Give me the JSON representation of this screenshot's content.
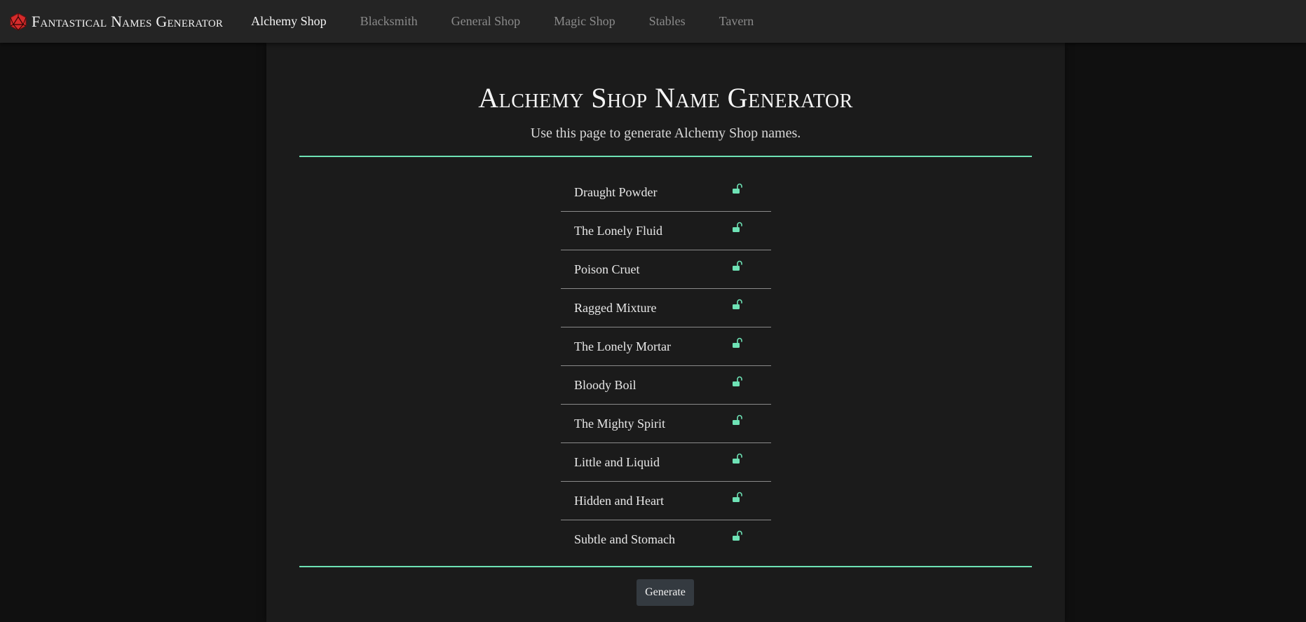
{
  "brand": {
    "name": "Fantastical Names Generator",
    "icon": "d20-icon",
    "icon_color": "#d62b2b"
  },
  "nav": {
    "items": [
      {
        "label": "Alchemy Shop",
        "active": true
      },
      {
        "label": "Blacksmith",
        "active": false
      },
      {
        "label": "General Shop",
        "active": false
      },
      {
        "label": "Magic Shop",
        "active": false
      },
      {
        "label": "Stables",
        "active": false
      },
      {
        "label": "Tavern",
        "active": false
      }
    ]
  },
  "main": {
    "title": "Alchemy Shop Name Generator",
    "subtitle": "Use this page to generate Alchemy Shop names.",
    "names": [
      {
        "text": "Draught Powder",
        "locked": false
      },
      {
        "text": "The Lonely Fluid",
        "locked": false
      },
      {
        "text": "Poison Cruet",
        "locked": false
      },
      {
        "text": "Ragged Mixture",
        "locked": false
      },
      {
        "text": "The Lonely Mortar",
        "locked": false
      },
      {
        "text": "Bloody Boil",
        "locked": false
      },
      {
        "text": "The Mighty Spirit",
        "locked": false
      },
      {
        "text": "Little and Liquid",
        "locked": false
      },
      {
        "text": "Hidden and Heart",
        "locked": false
      },
      {
        "text": "Subtle and Stomach",
        "locked": false
      }
    ],
    "generate_label": "Generate"
  },
  "colors": {
    "accent": "#6ee2b5",
    "lock_icon": "#6ee2b5",
    "button_bg": "#343a40"
  },
  "icons": {
    "lock": "unlock-icon"
  }
}
